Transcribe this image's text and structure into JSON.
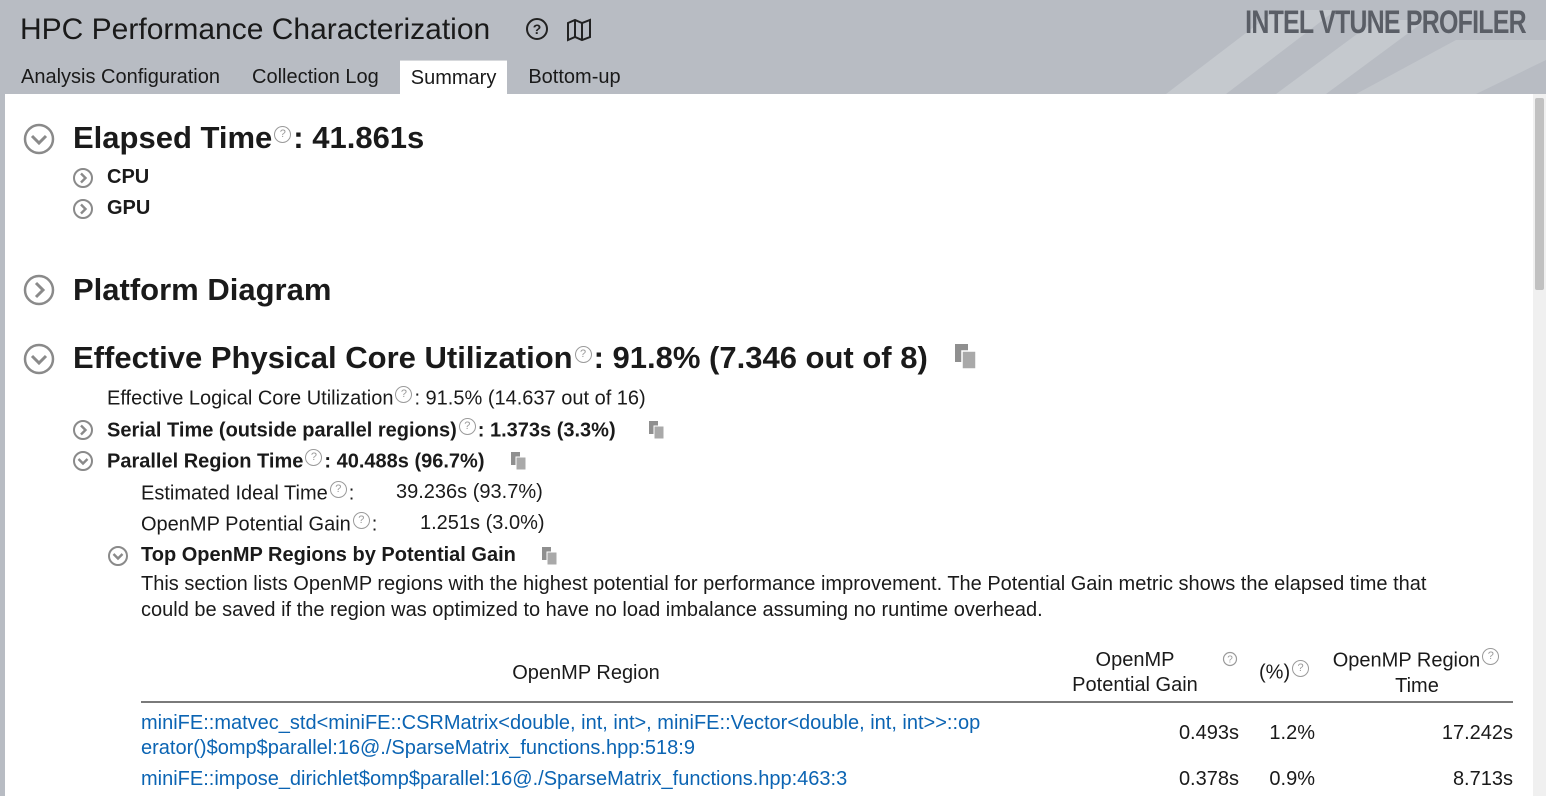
{
  "app": {
    "title": "HPC Performance Characterization",
    "brand": "INTEL VTUNE PROFILER",
    "help_icon": "question-circle-icon",
    "guide_icon": "book-map-icon"
  },
  "tabs": [
    {
      "label": "Analysis Configuration",
      "active": false
    },
    {
      "label": "Collection Log",
      "active": false
    },
    {
      "label": "Summary",
      "active": true
    },
    {
      "label": "Bottom-up",
      "active": false
    }
  ],
  "summary": {
    "elapsed": {
      "label": "Elapsed Time",
      "help": "?",
      "value": ": 41.861s",
      "children": [
        {
          "label": "CPU"
        },
        {
          "label": "GPU"
        }
      ]
    },
    "platform": {
      "label": "Platform Diagram"
    },
    "core_util": {
      "label": "Effective Physical Core Utilization",
      "help": "?",
      "value": ": 91.8% (7.346 out of 8)",
      "logical": {
        "label": "Effective Logical Core Utilization",
        "help": "?",
        "value": ": 91.5% (14.637 out of 16)"
      },
      "serial": {
        "label": "Serial Time (outside parallel regions)",
        "help": "?",
        "value": ": 1.373s (3.3%)"
      },
      "parallel": {
        "label": "Parallel Region Time",
        "help": "?",
        "value": ": 40.488s (96.7%)",
        "ideal": {
          "label": "Estimated Ideal Time",
          "help": "?",
          "colon": ":",
          "value": "39.236s (93.7%)"
        },
        "gain": {
          "label": "OpenMP Potential Gain",
          "help": "?",
          "colon": ":",
          "value": "1.251s (3.0%)"
        },
        "top_regions": {
          "label": "Top OpenMP Regions by Potential Gain",
          "description_line1": "This section lists OpenMP regions with the highest potential for performance improvement. The Potential Gain metric shows the elapsed time that",
          "description_line2": "could be saved if the region was optimized to have no load imbalance assuming no runtime overhead.",
          "columns": {
            "region": "OpenMP Region",
            "gain_line1": "OpenMP",
            "gain_line2": "Potential Gain",
            "pct": "(%)",
            "time_line1": "OpenMP Region",
            "time_line2": "Time",
            "help": "?"
          },
          "rows": [
            {
              "region_line1": "miniFE::matvec_std<miniFE::CSRMatrix<double, int, int>, miniFE::Vector<double, int, int>>::op",
              "region_line2": "erator()$omp$parallel:16@./SparseMatrix_functions.hpp:518:9",
              "gain": "0.493s",
              "pct": "1.2%",
              "time": "17.242s"
            },
            {
              "region_line1": "miniFE::impose_dirichlet$omp$parallel:16@./SparseMatrix_functions.hpp:463:3",
              "gain": "0.378s",
              "pct": "0.9%",
              "time": "8.713s"
            }
          ]
        }
      }
    }
  },
  "colors": {
    "header_bg": "#b8bcc3",
    "link": "#0b64b3",
    "help_grey": "#9a9a9a",
    "expander": "#8a8a8a"
  },
  "icons": {
    "expand": "chevron-right-circle-icon",
    "collapse": "chevron-down-circle-icon",
    "copy": "copy-icon",
    "help": "help-circle-icon"
  }
}
